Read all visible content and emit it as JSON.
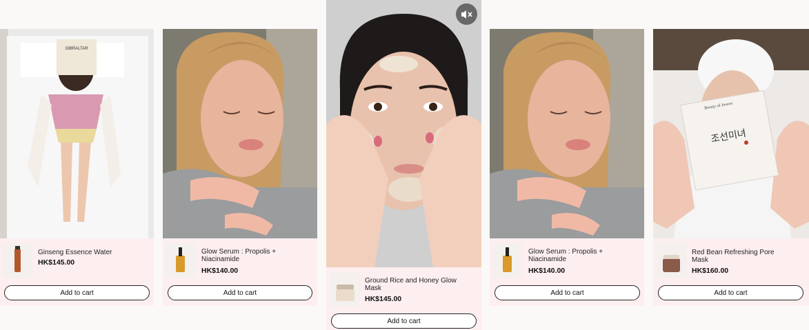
{
  "cards": [
    {
      "name": "Ginseng Essence Water",
      "price": "HK$145.00",
      "button": "Add to cart",
      "product_color": "#b0592e"
    },
    {
      "name": "Glow Serum : Propolis + Niacinamide",
      "price": "HK$140.00",
      "button": "Add to cart",
      "product_color": "#d99a2b"
    },
    {
      "name": "Ground Rice and Honey Glow Mask",
      "price": "HK$145.00",
      "button": "Add to cart",
      "product_color": "#e9dccb"
    },
    {
      "name": "Glow Serum : Propolis + Niacinamide",
      "price": "HK$140.00",
      "button": "Add to cart",
      "product_color": "#d99a2b"
    },
    {
      "name": "Red Bean Refreshing Pore Mask",
      "price": "HK$160.00",
      "button": "Add to cart",
      "product_color": "#8a5a4a"
    }
  ],
  "video": {
    "mute_icon": "speaker-muted-icon"
  },
  "box_text": {
    "brand": "Beauty of Joseon",
    "korean": "조선미녀"
  },
  "book_text": "GIBRALTAR"
}
